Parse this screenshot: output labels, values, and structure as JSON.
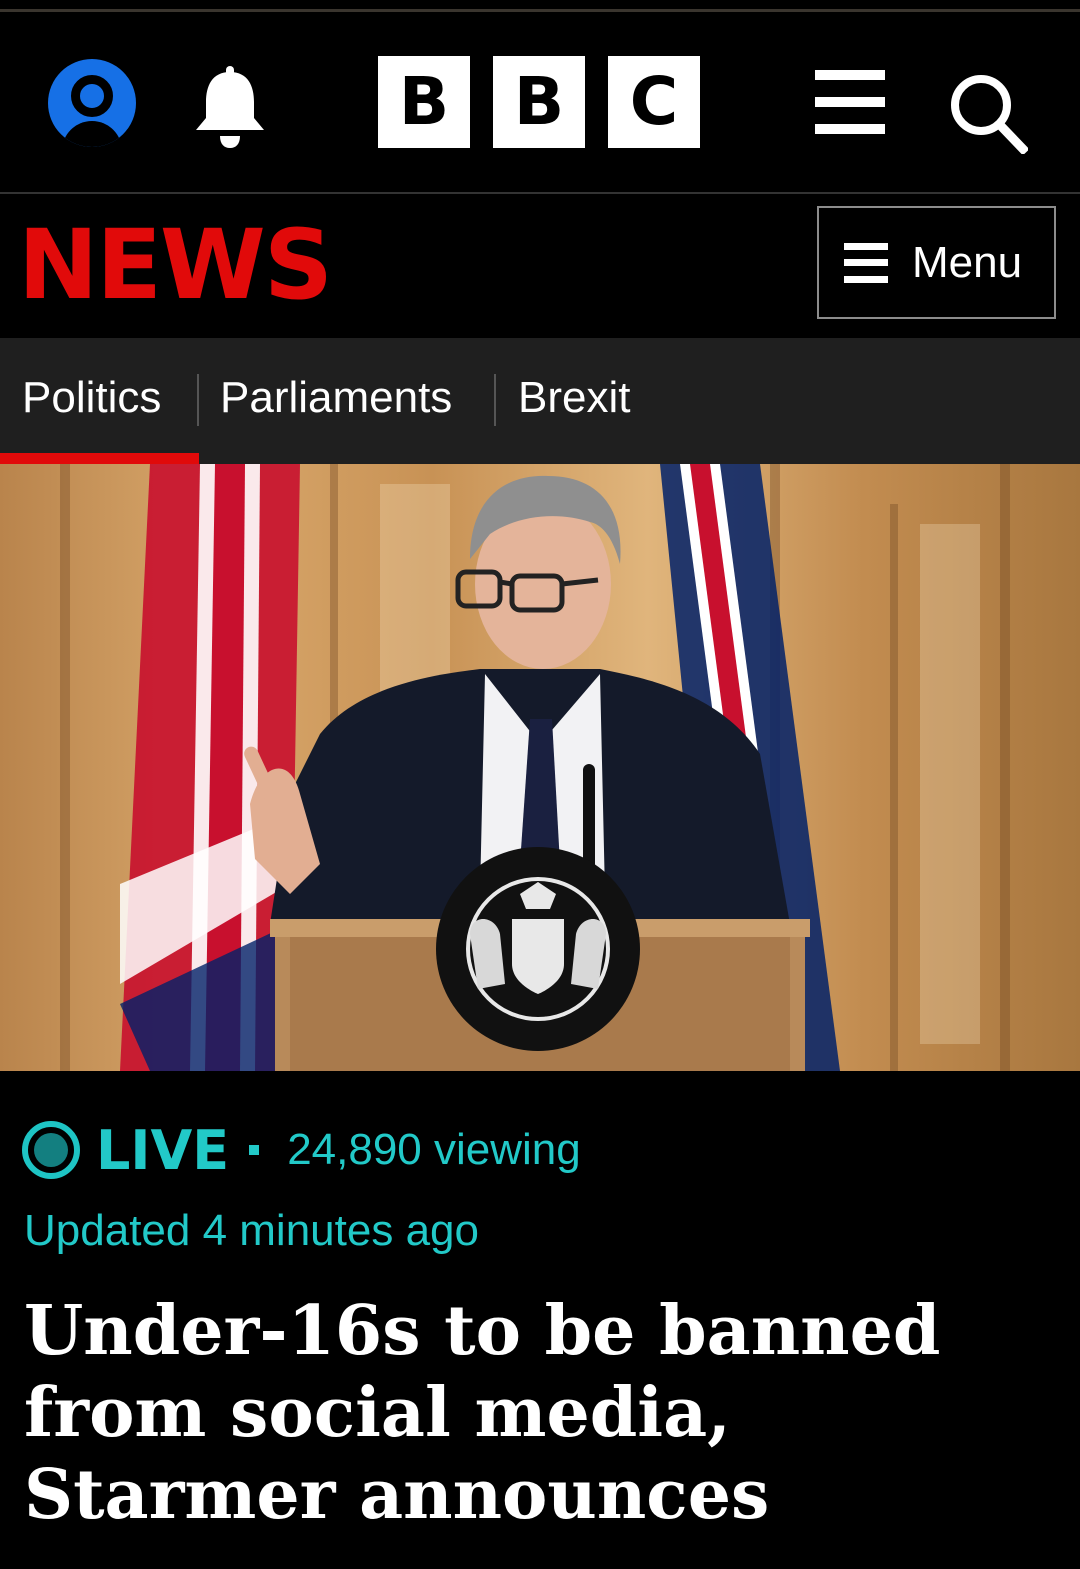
{
  "header": {
    "logo_letters": [
      "B",
      "B",
      "C"
    ],
    "icons": {
      "account": "account-icon",
      "notifications": "bell-icon",
      "menu": "hamburger-icon",
      "search": "search-icon"
    }
  },
  "news_bar": {
    "wordmark": "NEWS",
    "menu_label": "Menu"
  },
  "section_nav": {
    "items": [
      {
        "label": "Politics",
        "active": true
      },
      {
        "label": "Parliaments",
        "active": false
      },
      {
        "label": "Brexit",
        "active": false
      }
    ]
  },
  "article": {
    "live_label": "LIVE",
    "viewers": "24,890 viewing",
    "updated": "Updated 4 minutes ago",
    "headline": "Under-16s to be banned from social media, Starmer announces"
  },
  "colors": {
    "news_red": "#e10a0a",
    "live_teal": "#22c9c8",
    "account_blue": "#1670e6"
  }
}
